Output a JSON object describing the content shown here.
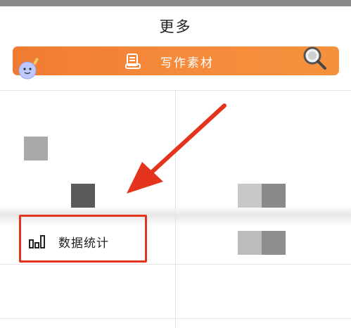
{
  "header": {
    "title": "更多"
  },
  "banner": {
    "label": "写作素材",
    "color": "#f58a3a"
  },
  "menu": {
    "data_stats_label": "数据统计"
  },
  "annotation": {
    "arrow_color": "#e5341d",
    "highlight_color": "#e5341d"
  },
  "icons": {
    "banner_icon": "document-icon",
    "mascot": "mascot-icon",
    "magnifier": "magnifier-icon",
    "stats_icon": "bar-chart-icon"
  }
}
